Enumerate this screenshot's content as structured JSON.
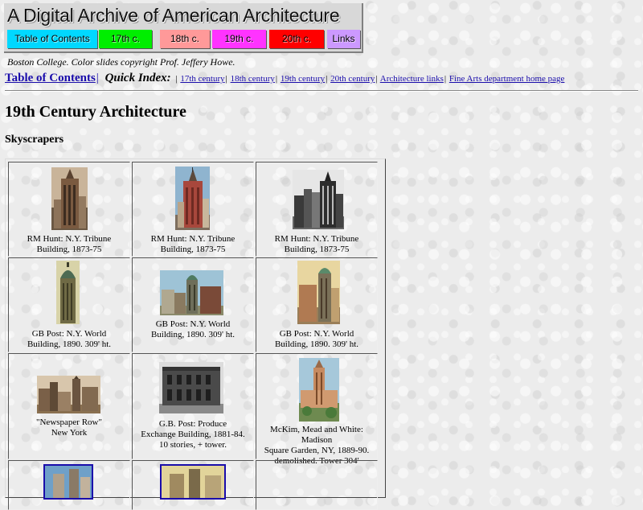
{
  "banner": {
    "title": "A Digital Archive of American Architecture",
    "nav": [
      {
        "label": "Table of Contents",
        "color": "#00d8ff"
      },
      {
        "label": "17th c.",
        "color": "#00ee00"
      },
      {
        "label": "18th c.",
        "color": "#ff9999"
      },
      {
        "label": "19th c.",
        "color": "#ff33ff"
      },
      {
        "label": "20th c.",
        "color": "#ff0000"
      },
      {
        "label": "Links",
        "color": "#cc99ff"
      }
    ]
  },
  "credit": "Boston College. Color slides copyright Prof. Jeffery Howe.",
  "quick_index": {
    "toc_label": "Table of Contents",
    "label": "Quick Index:",
    "links": [
      "17th century",
      "18th century",
      "19th century",
      "20th century",
      "Architecture links",
      "Fine Arts department home page"
    ]
  },
  "page_title": "19th Century Architecture",
  "section_title": "Skyscrapers",
  "grid": [
    {
      "caption_lines": [
        "RM Hunt: N.Y. Tribune",
        "Building, 1873-75"
      ],
      "thumb_tone": "sepia"
    },
    {
      "caption_lines": [
        "RM Hunt: N.Y. Tribune",
        "Building, 1873-75"
      ],
      "thumb_tone": "color"
    },
    {
      "caption_lines": [
        "RM Hunt: N.Y. Tribune",
        "Building, 1873-75"
      ],
      "thumb_tone": "bw"
    },
    {
      "caption_lines": [
        "GB Post: N.Y. World",
        "Building, 1890.  309' ht."
      ],
      "thumb_tone": "sepia"
    },
    {
      "caption_lines": [
        "GB Post: N.Y. World",
        "Building, 1890.  309' ht."
      ],
      "thumb_tone": "color"
    },
    {
      "caption_lines": [
        "GB Post: N.Y. World",
        "Building, 1890.  309' ht."
      ],
      "thumb_tone": "color"
    },
    {
      "caption_lines": [
        "\"Newspaper Row\"",
        "New York"
      ],
      "thumb_tone": "sepia"
    },
    {
      "caption_lines": [
        "G.B. Post: Produce",
        "Exchange Building, 1881-84.",
        "10 stories, + tower."
      ],
      "thumb_tone": "bw"
    },
    {
      "caption_lines": [
        "McKim, Mead and White: Madison",
        "Square Garden, NY, 1889-90.",
        "demolished. Tower 304'"
      ],
      "thumb_tone": "color"
    },
    {
      "caption_lines": [],
      "thumb_tone": "blue"
    },
    {
      "caption_lines": [],
      "thumb_tone": "color"
    },
    {
      "caption_lines": [],
      "thumb_tone": "none"
    }
  ]
}
